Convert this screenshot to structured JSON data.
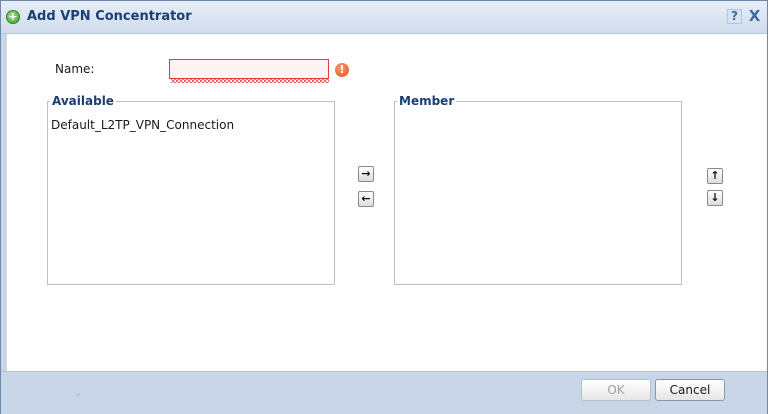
{
  "dialog": {
    "title": "Add VPN Concentrator",
    "help_label": "?",
    "close_label": "X"
  },
  "form": {
    "name_label": "Name:",
    "name_value": "",
    "error_icon": "!"
  },
  "available": {
    "legend": "Available",
    "items": [
      "Default_L2TP_VPN_Connection"
    ]
  },
  "member": {
    "legend": "Member",
    "items": []
  },
  "transfer": {
    "add_icon": "→",
    "remove_icon": "←"
  },
  "order": {
    "up_icon": "↑",
    "down_icon": "↓"
  },
  "footer": {
    "expander_icon": "⌄",
    "ok_label": "OK",
    "cancel_label": "Cancel"
  },
  "colors": {
    "title_text": "#1b3f73",
    "error": "#e23b3b",
    "frame": "#c8d6e8"
  }
}
